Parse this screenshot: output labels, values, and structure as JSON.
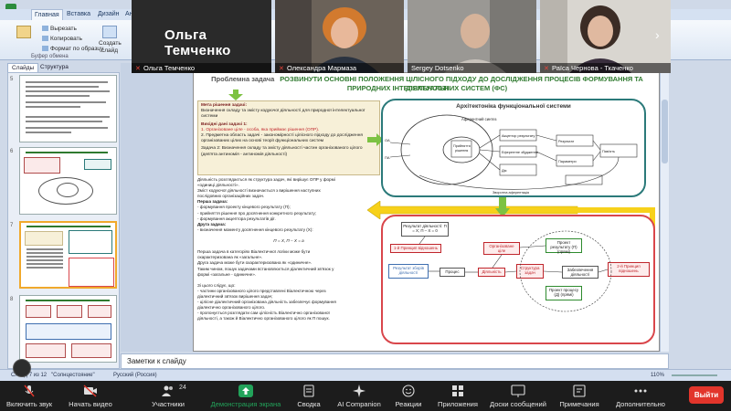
{
  "colors": {
    "share_green": "#22a35a",
    "end_red": "#e2352b",
    "slide_title_green": "#2f7a2f",
    "diagram_teal": "#2b7a7a",
    "diagram_red": "#d9464b"
  },
  "ppt": {
    "tabs": [
      "Главная",
      "Вставка",
      "Дизайн",
      "Ан"
    ],
    "ribbon": {
      "cut": "Вырезать",
      "copy": "Копировать",
      "format_painter": "Формат по образцу",
      "new_slide": "Создать",
      "new_slide_2": "слайд",
      "clipboard_group": "Буфер обмена"
    },
    "panel_tabs": [
      "Слайды",
      "Структура"
    ],
    "slide_numbers": [
      "5",
      "6",
      "7",
      "8"
    ],
    "notes_placeholder": "Заметки к слайду",
    "status": {
      "slide_info": "Слайд 7 из 12",
      "theme": "\"Солнцестояние\"",
      "language": "Русский (Россия)",
      "zoom": "110%"
    }
  },
  "slide": {
    "problem_label": "Проблемна задача",
    "title_line1": "РОЗВИНУТИ ОСНОВНІ ПОЛОЖЕННЯ ЦІЛІСНОГО ПІДХОДУ ДО ДОСЛІДЖЕННЯ ПРОЦЕСІВ ФОРМУВАННЯ ТА ДІЯЛЬНОСТІ",
    "title_line2": "ПРИРОДНИХ ІНТЕЛЕКТУАЛЬНИХ СИСТЕМ (ФС)",
    "goal_heading": "Мета рішення задачі:",
    "goal_text": "Визначення складу та змісту кодуючої діяльності для природної інтелектуальної системи",
    "inputs_heading": "Вихідні дані задачі 1:",
    "input_1": "1. Організоване ціле - особа, яка приймає рішення (ОПР).",
    "input_2": "2. Предметна область задачі - закономірності цілісного підходу до дослідження організованих цілих на основі теорії функціональних систем",
    "task2": "Задача 2: Визначення складу та змісту діяльності частин організованого цілого (дев'ята антиномія - антиномія діяльності)",
    "body_lines": [
      "Діяльність розглядається як структура задач, які вирішує ОПР у формі",
      "«одиниці діяльності».",
      "Зміст кодуючої діяльності визначається з вирішення наступних",
      "послідовних організаційних задач.",
      "Перша задача:",
      "- формування проекту кінцевого результату (П);",
      "- прийняття рішення про досягнення конкретного результату;",
      "- формування акцептора результатів дії.",
      "Друга задача:",
      "- визначення моменту досягнення кінцевого результату (Х):",
      "",
      "П = Х,  П – Х = а",
      "",
      "Перша задача в категоріях Віалектичної логіки може бути",
      "охарактеризована як «загальне».",
      "Друга задача може бути охарактеризована як «одиничне».",
      "Таким чином, пошук задачами встановлюється діалектичний зв'язок у",
      "формі «загальне - одиничне».",
      "",
      "Зі цього слідує, що:",
      "- частини організованого цілого представлені Віалектичною через",
      "діалектичний зв'язок вирішення задач;",
      "- цілісне діалектичний організована діяльність забезпечує формування",
      "діалектично організованого цілого.",
      "- пропонується розглядати сам цілісність Віалектично організованої",
      "діяльності, а також й Віалектично організованого цілого як П пошук."
    ],
    "arch_title": "Архітектоніка функціональної системи",
    "arch_labels": [
      "Аферентний синтез",
      "Мотивація",
      "Прийняття рішення",
      "Акцептор результату",
      "Еферентне збудження",
      "Дія",
      "Результат",
      "Параметри результату",
      "Пам'ять",
      "ОА",
      "ПА",
      "Зворотна аферентація"
    ],
    "bottom_boxes": {
      "result_activity": "Результат діяльності: П = Х; П – Х = 0",
      "first_principle": "1-й Принцип відношень",
      "second_principle": "2-й Принцип відношень",
      "org_whole": "Організоване ціле",
      "project_result": "Проект результату (П) (прямі)",
      "project_process": "Проект процесу (Д) (прямі)",
      "result_meeting": "Результат зборів діяльності",
      "process": "Процес",
      "activity": "Діяльність",
      "task_structure": "Структура задач",
      "ensure": "Забезпечення діяльності"
    }
  },
  "zoom": {
    "presenter_name": "Ольга Темченко",
    "participants": [
      "Ольга Темченко",
      "Олександра Мармаза",
      "Sergey Dotsenko",
      "Раїса Чернова - Ткаченко"
    ],
    "toolbar": [
      {
        "icon": "mic-off-icon",
        "label": "Включить звук"
      },
      {
        "icon": "video-off-icon",
        "label": "Начать видео"
      },
      {
        "icon": "participants-icon",
        "label": "Участники",
        "count": "24"
      },
      {
        "icon": "share-screen-icon",
        "label": "Демонстрация экрана"
      },
      {
        "icon": "summary-icon",
        "label": "Сводка"
      },
      {
        "icon": "ai-companion-icon",
        "label": "AI Companion"
      },
      {
        "icon": "reactions-icon",
        "label": "Реакции"
      },
      {
        "icon": "apps-icon",
        "label": "Приложения"
      },
      {
        "icon": "whiteboard-icon",
        "label": "Доски сообщений"
      },
      {
        "icon": "notes-icon",
        "label": "Примечания"
      },
      {
        "icon": "more-icon",
        "label": "Дополнительно"
      }
    ],
    "end_label": "Выйти"
  }
}
